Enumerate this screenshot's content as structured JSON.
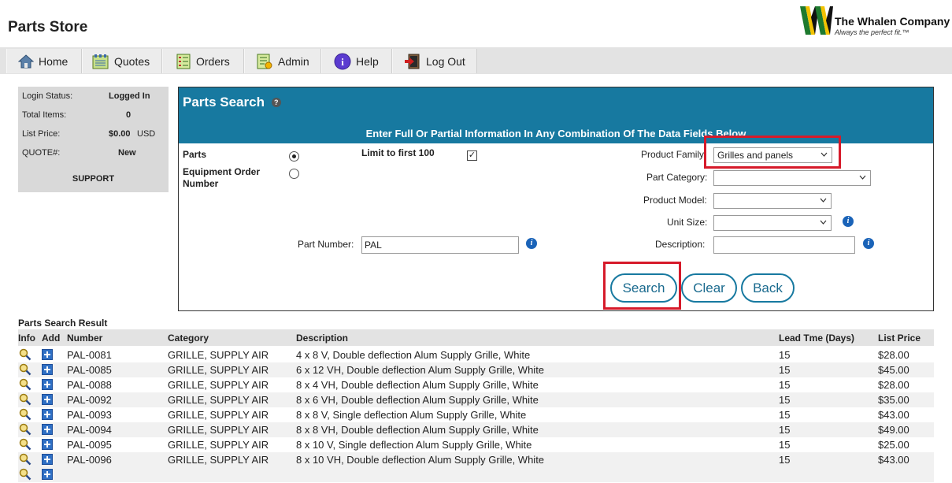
{
  "header": {
    "title": "Parts Store",
    "logo_name": "The Whalen Company",
    "logo_tagline": "Always the perfect fit.™"
  },
  "nav": [
    {
      "label": "Home",
      "icon": "home-icon"
    },
    {
      "label": "Quotes",
      "icon": "quotes-icon"
    },
    {
      "label": "Orders",
      "icon": "orders-icon"
    },
    {
      "label": "Admin",
      "icon": "admin-icon"
    },
    {
      "label": "Help",
      "icon": "help-icon"
    },
    {
      "label": "Log Out",
      "icon": "logout-icon"
    }
  ],
  "status": {
    "login_status_label": "Login Status:",
    "login_status_value": "Logged In",
    "total_items_label": "Total Items:",
    "total_items_value": "0",
    "list_price_label": "List Price:",
    "list_price_value": "$0.00",
    "list_price_currency": "USD",
    "quote_label": "QUOTE#:",
    "quote_value": "New",
    "support_label": "SUPPORT"
  },
  "search": {
    "title": "Parts Search",
    "help_glyph": "?",
    "subtitle": "Enter Full Or Partial Information In Any Combination Of The Data Fields Below",
    "parts_label": "Parts",
    "equipment_label": "Equipment Order Number",
    "limit_label": "Limit to first 100",
    "limit_checked": true,
    "search_mode": "Parts",
    "part_number_label": "Part Number:",
    "part_number_value": "PAL",
    "product_family_label": "Product Family:",
    "product_family_value": "Grilles and panels",
    "part_category_label": "Part Category:",
    "part_category_value": "",
    "product_model_label": "Product Model:",
    "product_model_value": "",
    "unit_size_label": "Unit Size:",
    "unit_size_value": "",
    "description_label": "Description:",
    "description_value": "",
    "search_button": "Search",
    "clear_button": "Clear",
    "back_button": "Back"
  },
  "results": {
    "title": "Parts Search Result",
    "columns": [
      "Info",
      "Add",
      "Number",
      "Category",
      "Description",
      "Lead Tme (Days)",
      "List Price"
    ],
    "rows": [
      {
        "number": "PAL-0081",
        "category": "GRILLE, SUPPLY AIR",
        "description": "4 x 8 V, Double deflection Alum Supply Grille, White",
        "lead": "15",
        "price": "$28.00"
      },
      {
        "number": "PAL-0085",
        "category": "GRILLE, SUPPLY AIR",
        "description": "6 x 12 VH, Double deflection Alum Supply Grille, White",
        "lead": "15",
        "price": "$45.00"
      },
      {
        "number": "PAL-0088",
        "category": "GRILLE, SUPPLY AIR",
        "description": "8 x 4 VH, Double deflection Alum Supply Grille, White",
        "lead": "15",
        "price": "$28.00"
      },
      {
        "number": "PAL-0092",
        "category": "GRILLE, SUPPLY AIR",
        "description": "8 x 6 VH, Double deflection Alum Supply Grille, White",
        "lead": "15",
        "price": "$35.00"
      },
      {
        "number": "PAL-0093",
        "category": "GRILLE, SUPPLY AIR",
        "description": "8 x 8 V, Single deflection Alum Supply Grille, White",
        "lead": "15",
        "price": "$43.00"
      },
      {
        "number": "PAL-0094",
        "category": "GRILLE, SUPPLY AIR",
        "description": "8 x 8 VH, Double deflection Alum Supply Grille, White",
        "lead": "15",
        "price": "$49.00"
      },
      {
        "number": "PAL-0095",
        "category": "GRILLE, SUPPLY AIR",
        "description": "8 x 10 V, Single deflection Alum Supply Grille, White",
        "lead": "15",
        "price": "$25.00"
      },
      {
        "number": "PAL-0096",
        "category": "GRILLE, SUPPLY AIR",
        "description": "8 x 10 VH, Double deflection Alum Supply Grille, White",
        "lead": "15",
        "price": "$43.00"
      }
    ]
  },
  "colors": {
    "panel_header": "#1779a0",
    "highlight": "#d61a2a",
    "button_text": "#1a6a8e"
  }
}
